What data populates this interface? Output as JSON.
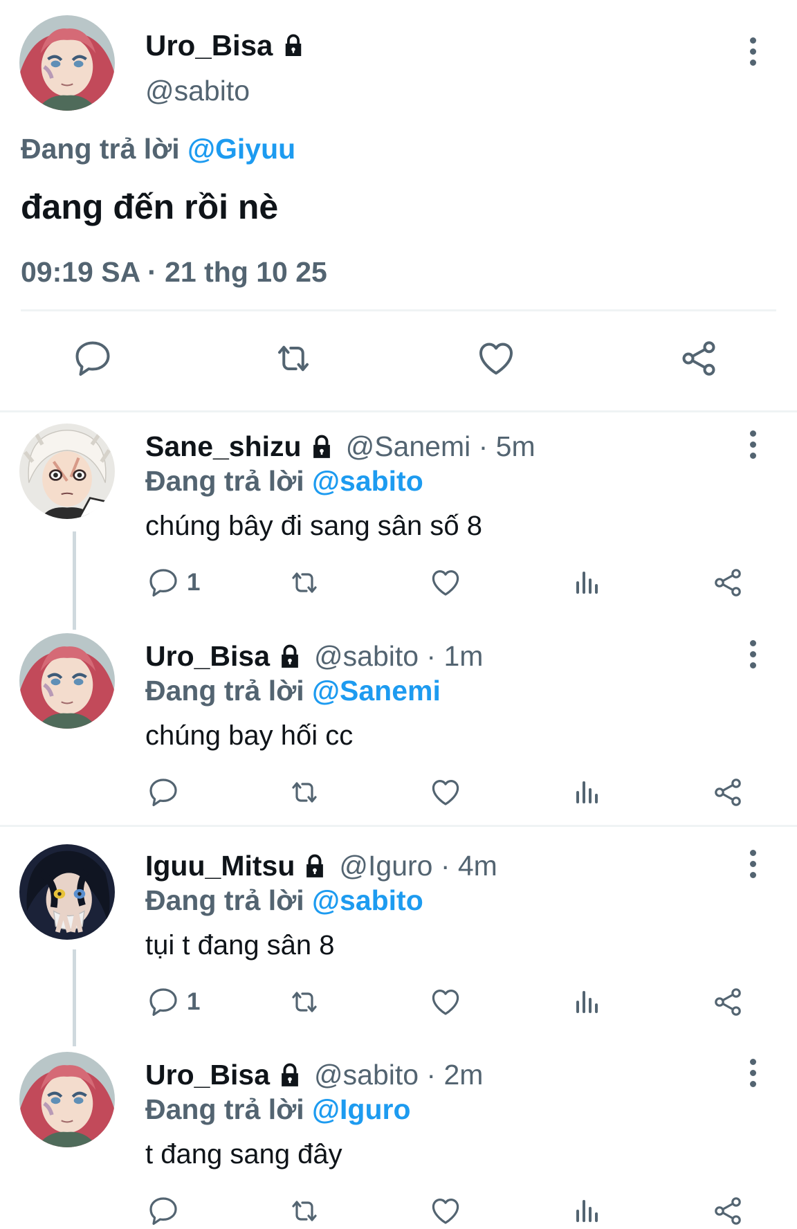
{
  "main_tweet": {
    "display_name": "Uro_Bisa",
    "handle": "@sabito",
    "reply_prefix": "Đang trả lời",
    "reply_to": "@Giyuu",
    "text": "đang đến rồi nè",
    "timestamp": "09:19 SA · 21 thg 10 25"
  },
  "replies": [
    {
      "display_name": "Sane_shizu",
      "handle_time": "@Sanemi · 5m",
      "reply_prefix": "Đang trả lời",
      "reply_to": "@sabito",
      "text": "chúng bây đi sang sân số 8",
      "reply_count": "1"
    },
    {
      "display_name": "Uro_Bisa",
      "handle_time": "@sabito · 1m",
      "reply_prefix": "Đang trả lời",
      "reply_to": "@Sanemi",
      "text": "chúng bay hối cc",
      "reply_count": ""
    },
    {
      "display_name": "Iguu_Mitsu",
      "handle_time": "@Iguro · 4m",
      "reply_prefix": "Đang trả lời",
      "reply_to": "@sabito",
      "text": "tụi t đang sân 8",
      "reply_count": "1"
    },
    {
      "display_name": "Uro_Bisa",
      "handle_time": "@sabito · 2m",
      "reply_prefix": "Đang trả lời",
      "reply_to": "@Iguro",
      "text": "t đang sang đây",
      "reply_count": ""
    }
  ],
  "icons": {
    "lock": "lock-icon",
    "more": "more-vertical-icon",
    "reply": "reply-icon",
    "retweet": "retweet-icon",
    "like": "heart-icon",
    "views": "views-chart-icon",
    "share": "share-icon"
  },
  "colors": {
    "accent": "#1d9bf0",
    "secondary_text": "#536471",
    "primary_text": "#0f1419",
    "divider": "#eff3f4"
  }
}
